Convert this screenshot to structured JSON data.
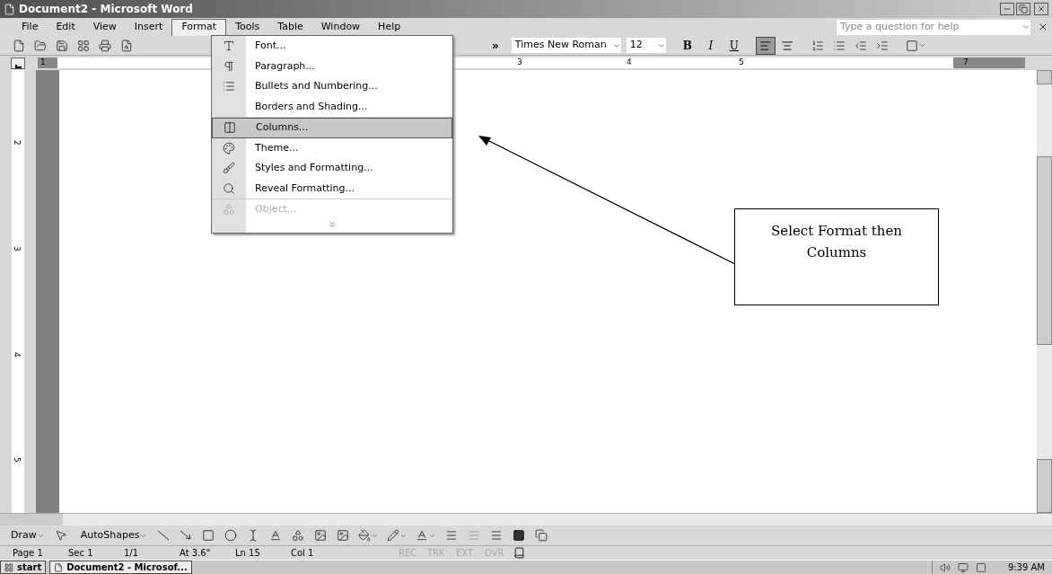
{
  "window": {
    "title": "Document2 - Microsoft Word"
  },
  "menu_bar": {
    "items": [
      {
        "label": "File",
        "selected": false
      },
      {
        "label": "Edit",
        "selected": false
      },
      {
        "label": "View",
        "selected": false
      },
      {
        "label": "Insert",
        "selected": false
      },
      {
        "label": "Format",
        "selected": true
      },
      {
        "label": "Tools",
        "selected": false
      },
      {
        "label": "Table",
        "selected": false
      },
      {
        "label": "Window",
        "selected": false
      },
      {
        "label": "Help",
        "selected": false
      }
    ],
    "help_box": {
      "placeholder": "Type a question for help"
    }
  },
  "toolbar": {
    "chevron": "»",
    "font": "Times New Roman",
    "size": "12",
    "styles": [
      "B",
      "I",
      "U"
    ],
    "alignment": [
      {
        "selected": true
      },
      {
        "selected": false
      }
    ]
  },
  "horizontal_ruler": {
    "numbers": [
      "1",
      "3",
      "4",
      "5",
      "7"
    ]
  },
  "vertical_ruler": {
    "numbers": [
      "2",
      "3",
      "4",
      "5"
    ]
  },
  "format_menu": {
    "groups": [
      [
        {
          "label": "Font...",
          "selected": false,
          "disabled": false
        },
        {
          "label": "Paragraph...",
          "selected": false,
          "disabled": false
        },
        {
          "label": "Bullets and Numbering...",
          "selected": false,
          "disabled": false
        },
        {
          "label": "Borders and Shading...",
          "selected": false,
          "disabled": false
        }
      ],
      [
        {
          "label": "Columns...",
          "selected": true,
          "disabled": false
        },
        {
          "label": "Theme...",
          "selected": false,
          "disabled": false
        },
        {
          "label": "Styles and Formatting...",
          "selected": false,
          "disabled": false
        },
        {
          "label": "Reveal Formatting...",
          "selected": false,
          "disabled": false
        }
      ],
      [
        {
          "label": "Object...",
          "selected": false,
          "disabled": true
        }
      ]
    ]
  },
  "callout": {
    "text": "Select Format then Columns"
  },
  "drawing_toolbar": {
    "draw": "Draw",
    "autoshapes": "AutoShapes"
  },
  "status_bar": {
    "fields": [
      {
        "label": "Page 1",
        "disabled": false
      },
      {
        "label": "Sec 1",
        "disabled": false
      },
      {
        "label": "1/1",
        "disabled": false
      },
      {
        "label": "At 3.6\"",
        "disabled": false
      },
      {
        "label": "Ln 15",
        "disabled": false
      },
      {
        "label": "Col 1",
        "disabled": false
      },
      {
        "label": "REC",
        "disabled": true
      },
      {
        "label": "TRK",
        "disabled": true
      },
      {
        "label": "EXT",
        "disabled": true
      },
      {
        "label": "OVR",
        "disabled": true
      }
    ]
  },
  "taskbar": {
    "start": "start",
    "task": "Document2 - Microsof...",
    "time": "9:39 AM"
  }
}
